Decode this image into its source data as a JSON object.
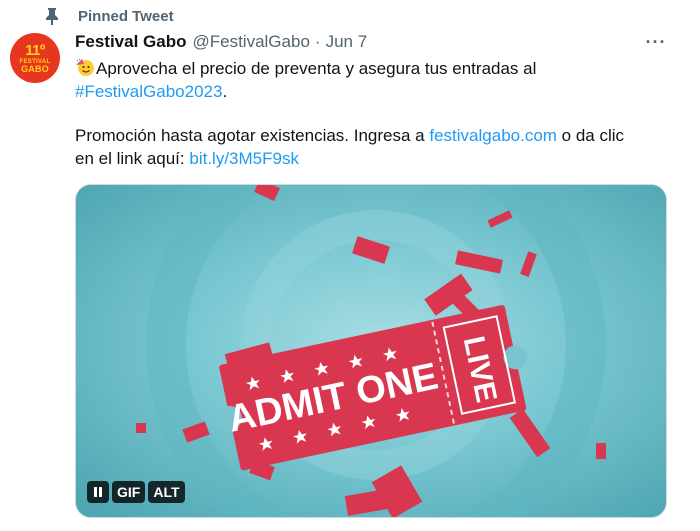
{
  "pinned": {
    "label": "Pinned Tweet"
  },
  "avatar": {
    "line1": "11º",
    "line2": "FESTIVAL",
    "line3": "GABO"
  },
  "tweet": {
    "display_name": "Festival Gabo",
    "handle": "@FestivalGabo",
    "separator": "·",
    "date": "Jun 7",
    "more": "···",
    "line1_text": "Aprovecha el precio de preventa y asegura tus entradas al",
    "hashtag": "#FestivalGabo2023",
    "hashtag_suffix": ".",
    "line3_text": "Promoción hasta agotar existencias. Ingresa a ",
    "site_link": "festivalgabo.com",
    "line3_suffix": " o da clic",
    "line4_text": "en el link aquí: ",
    "short_link": "bit.ly/3M5F9sk"
  },
  "media": {
    "ticket_main": "ADMIT ONE",
    "ticket_stub": "LIVE",
    "controls": {
      "gif": "GIF",
      "alt": "ALT"
    }
  },
  "colors": {
    "accent": "#1d9bf0",
    "ticket": "#d8374f",
    "background": "#64b7c3"
  },
  "icons": {
    "pin": "pin-icon",
    "emoji": "emoji-icon",
    "pause": "pause-icon"
  }
}
